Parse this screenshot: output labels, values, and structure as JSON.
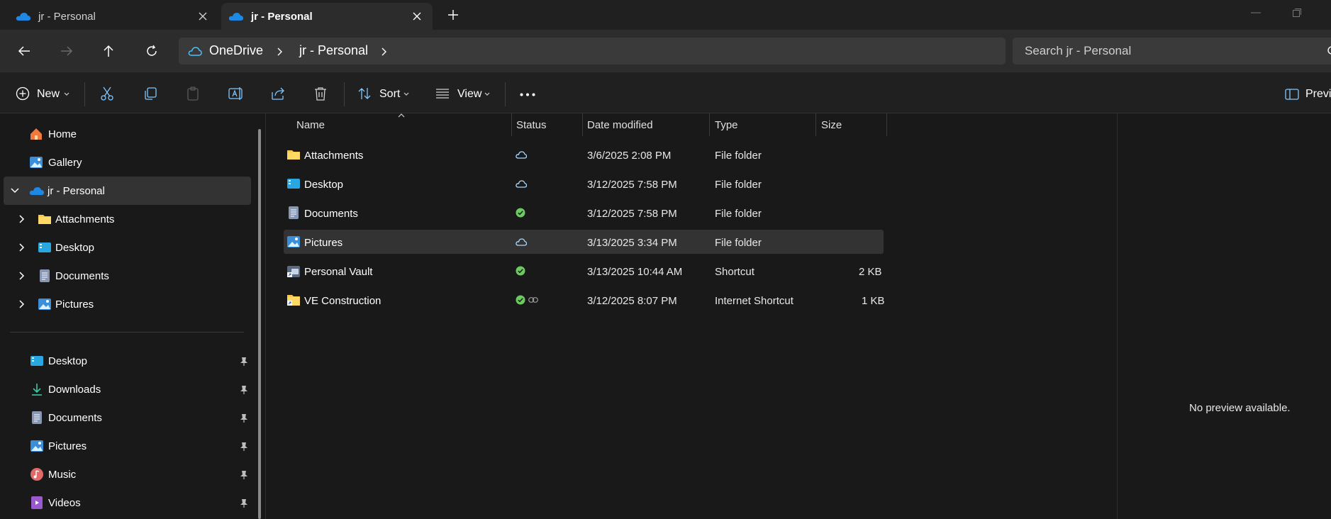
{
  "tabs": [
    {
      "label": "jr - Personal",
      "active": false
    },
    {
      "label": "jr - Personal",
      "active": true
    }
  ],
  "address": {
    "crumbs": [
      "OneDrive",
      "jr - Personal"
    ],
    "search_placeholder": "Search jr - Personal"
  },
  "toolbar": {
    "new_label": "New",
    "sort_label": "Sort",
    "view_label": "View",
    "preview_label": "Previe"
  },
  "nav": {
    "home": "Home",
    "gallery": "Gallery",
    "onedrive": "jr - Personal",
    "children": [
      "Attachments",
      "Desktop",
      "Documents",
      "Pictures"
    ],
    "pinned": [
      "Desktop",
      "Downloads",
      "Documents",
      "Pictures",
      "Music",
      "Videos"
    ]
  },
  "columns": {
    "name": "Name",
    "status": "Status",
    "date": "Date modified",
    "type": "Type",
    "size": "Size"
  },
  "files": [
    {
      "name": "Attachments",
      "date": "3/6/2025 2:08 PM",
      "type": "File folder",
      "size": "",
      "status": "cloud-icon"
    },
    {
      "name": "Desktop",
      "date": "3/12/2025 7:58 PM",
      "type": "File folder",
      "size": "",
      "status": "cloud-icon"
    },
    {
      "name": "Documents",
      "date": "3/12/2025 7:58 PM",
      "type": "File folder",
      "size": "",
      "status": "synced-check-icon"
    },
    {
      "name": "Pictures",
      "date": "3/13/2025 3:34 PM",
      "type": "File folder",
      "size": "",
      "status": "cloud-icon"
    },
    {
      "name": "Personal Vault",
      "date": "3/13/2025 10:44 AM",
      "type": "Shortcut",
      "size": "2 KB",
      "status": "synced-check-icon"
    },
    {
      "name": "VE Construction",
      "date": "3/12/2025 8:07 PM",
      "type": "Internet Shortcut",
      "size": "1 KB",
      "status": "synced-check-icon"
    }
  ],
  "preview": {
    "message": "No preview available."
  },
  "colors": {
    "accent": "#4cc2ff",
    "folder": "#f8c94a",
    "check": "#6ccb5f",
    "background": "#191919"
  }
}
